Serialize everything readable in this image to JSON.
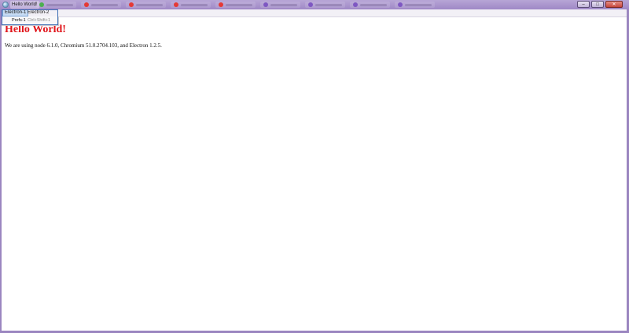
{
  "window": {
    "title": "Hello World!",
    "controls": {
      "minimize": "–",
      "maximize": "□",
      "close": "✕"
    }
  },
  "menubar": {
    "items": [
      {
        "label": "Electron-1",
        "active": true
      },
      {
        "label": "Electron-2",
        "active": false
      }
    ]
  },
  "dropdown": {
    "items": [
      {
        "label": "Prefs-1",
        "accelerator": "Ctrl+Shift+1"
      }
    ]
  },
  "content": {
    "heading": "Hello World!",
    "paragraph": "We are using node 6.1.0, Chromium 51.0.2704.103, and Electron 1.2.5."
  },
  "colors": {
    "heading": "#e0151b",
    "frame": "#9f88c6",
    "dropdown_border": "#3e6fb5"
  },
  "icons": {
    "app": "electron-app-icon"
  }
}
